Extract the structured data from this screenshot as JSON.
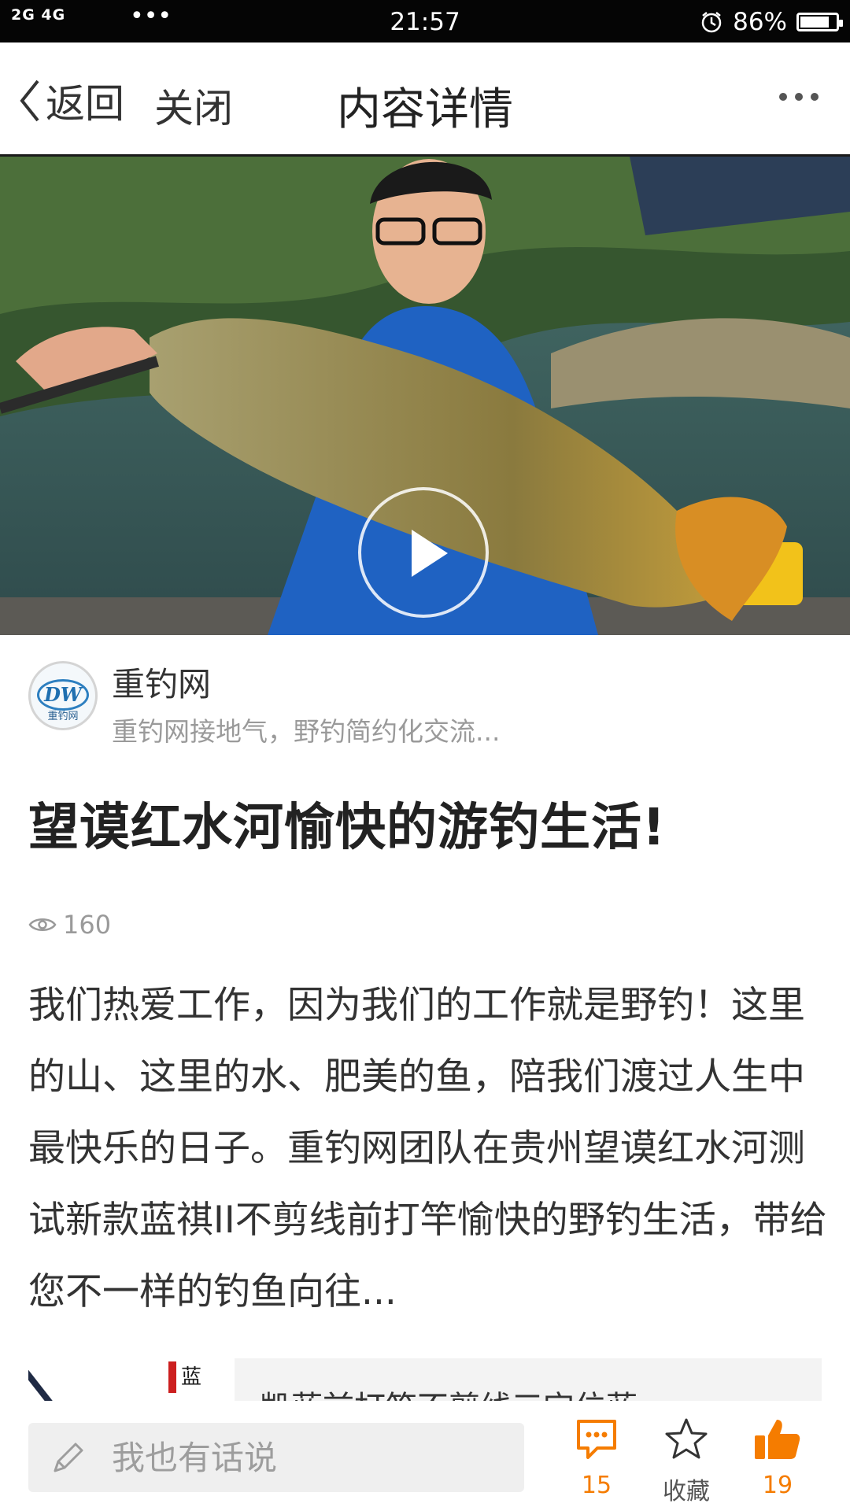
{
  "status_bar": {
    "signal": "2G 4G",
    "more": "•••",
    "time": "21:57",
    "battery": "86%",
    "battery_level": 0.86
  },
  "nav": {
    "back_label": "返回",
    "close_label": "关闭",
    "title": "内容详情"
  },
  "author": {
    "name": "重钓网",
    "description": "重钓网接地气，野钓简约化交流...",
    "logo_text": "DW",
    "logo_cn": "重钓网"
  },
  "article": {
    "title": "望谟红水河愉快的游钓生活!",
    "views": "160",
    "body": "我们热爱工作，因为我们的工作就是野钓！这里的山、这里的水、肥美的鱼，陪我们渡过人生中最快乐的日子。重钓网团队在贵州望谟红水河测试新款蓝祺II不剪线前打竿愉快的野钓生活，带给您不一样的钓鱼向往..."
  },
  "related": {
    "thumb_label": "蓝",
    "title": "凯蓝前打竿不剪线三宝位蓝"
  },
  "bottom_bar": {
    "comment_placeholder": "我也有话说",
    "comment_count": "15",
    "favorite_label": "收藏",
    "like_count": "19"
  },
  "colors": {
    "accent": "#f57c00",
    "status_bar": "#050505"
  }
}
